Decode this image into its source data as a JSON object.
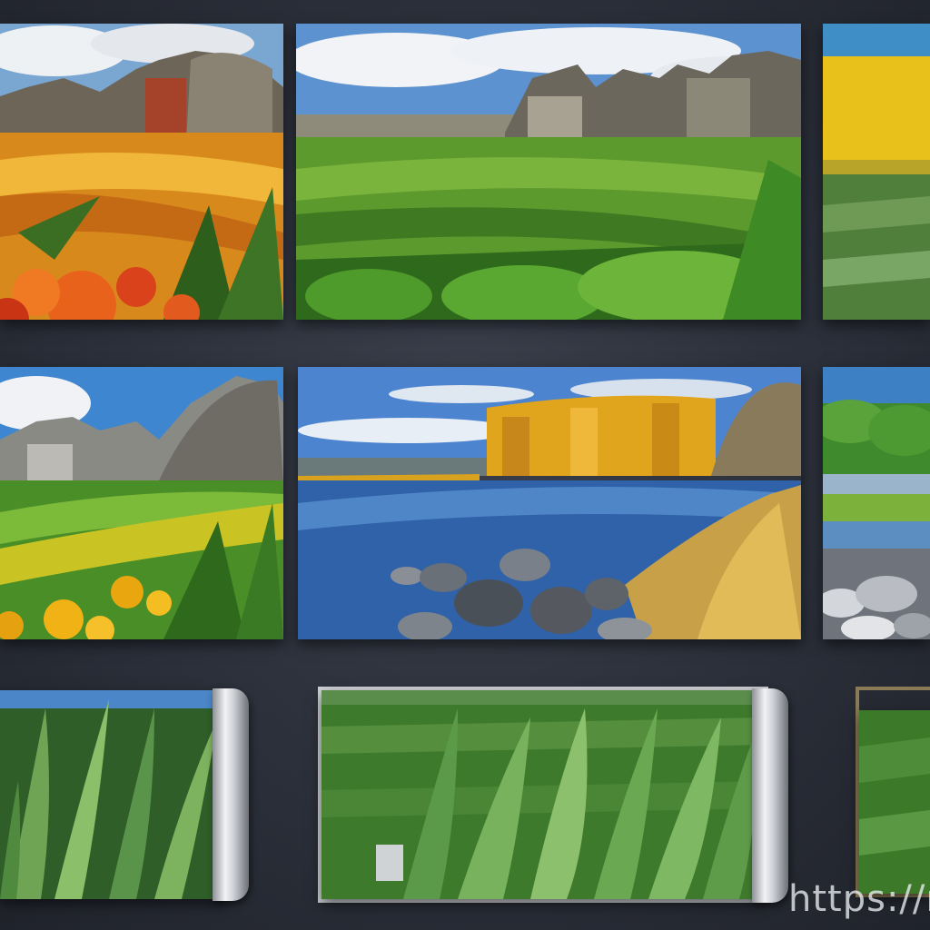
{
  "gallery": {
    "tiles": [
      {
        "scene": "orange-flower-field-with-stone-ruins"
      },
      {
        "scene": "green-crop-field-with-stone-ruins"
      },
      {
        "scene": "yellow-and-green-field"
      },
      {
        "scene": "green-field-with-yellow-flowers-and-ruins"
      },
      {
        "scene": "blue-lake-with-golden-trees-and-rocks"
      },
      {
        "scene": "river-with-trees-and-rocks"
      },
      {
        "scene": "grass-scroll"
      },
      {
        "scene": "grass-field-scroll"
      },
      {
        "scene": "grass-scroll-cropped"
      }
    ]
  },
  "watermark": {
    "text": "https://n"
  },
  "colors": {
    "background": "#2a2e38",
    "sky": "#4a86c8",
    "grass": "#4f8a2c",
    "gold": "#e0a51c",
    "water": "#2f62a8"
  }
}
